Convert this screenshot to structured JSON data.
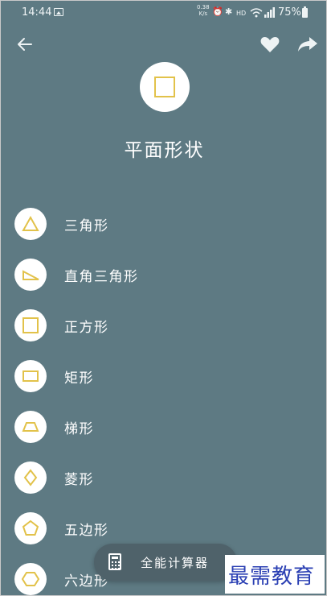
{
  "status_bar": {
    "time": "14:44",
    "net_speed_value": "0.38",
    "net_speed_unit": "K/s",
    "hd_label": "HD",
    "battery_percent": "75%"
  },
  "header": {
    "title": "平面形状"
  },
  "shape_items": [
    {
      "label": "三角形",
      "icon": "triangle-icon"
    },
    {
      "label": "直角三角形",
      "icon": "right-triangle-icon"
    },
    {
      "label": "正方形",
      "icon": "square-icon"
    },
    {
      "label": "矩形",
      "icon": "rectangle-icon"
    },
    {
      "label": "梯形",
      "icon": "trapezoid-icon"
    },
    {
      "label": "菱形",
      "icon": "rhombus-icon"
    },
    {
      "label": "五边形",
      "icon": "pentagon-icon"
    },
    {
      "label": "六边形",
      "icon": "hexagon-icon"
    }
  ],
  "fab": {
    "label": "全能计算器",
    "icon": "calculator-icon"
  },
  "watermark": "最需教育",
  "colors": {
    "background": "#5e7a83",
    "accent": "#e2c24a",
    "fab_background": "#4f626a",
    "watermark": "#2a3fb3"
  }
}
